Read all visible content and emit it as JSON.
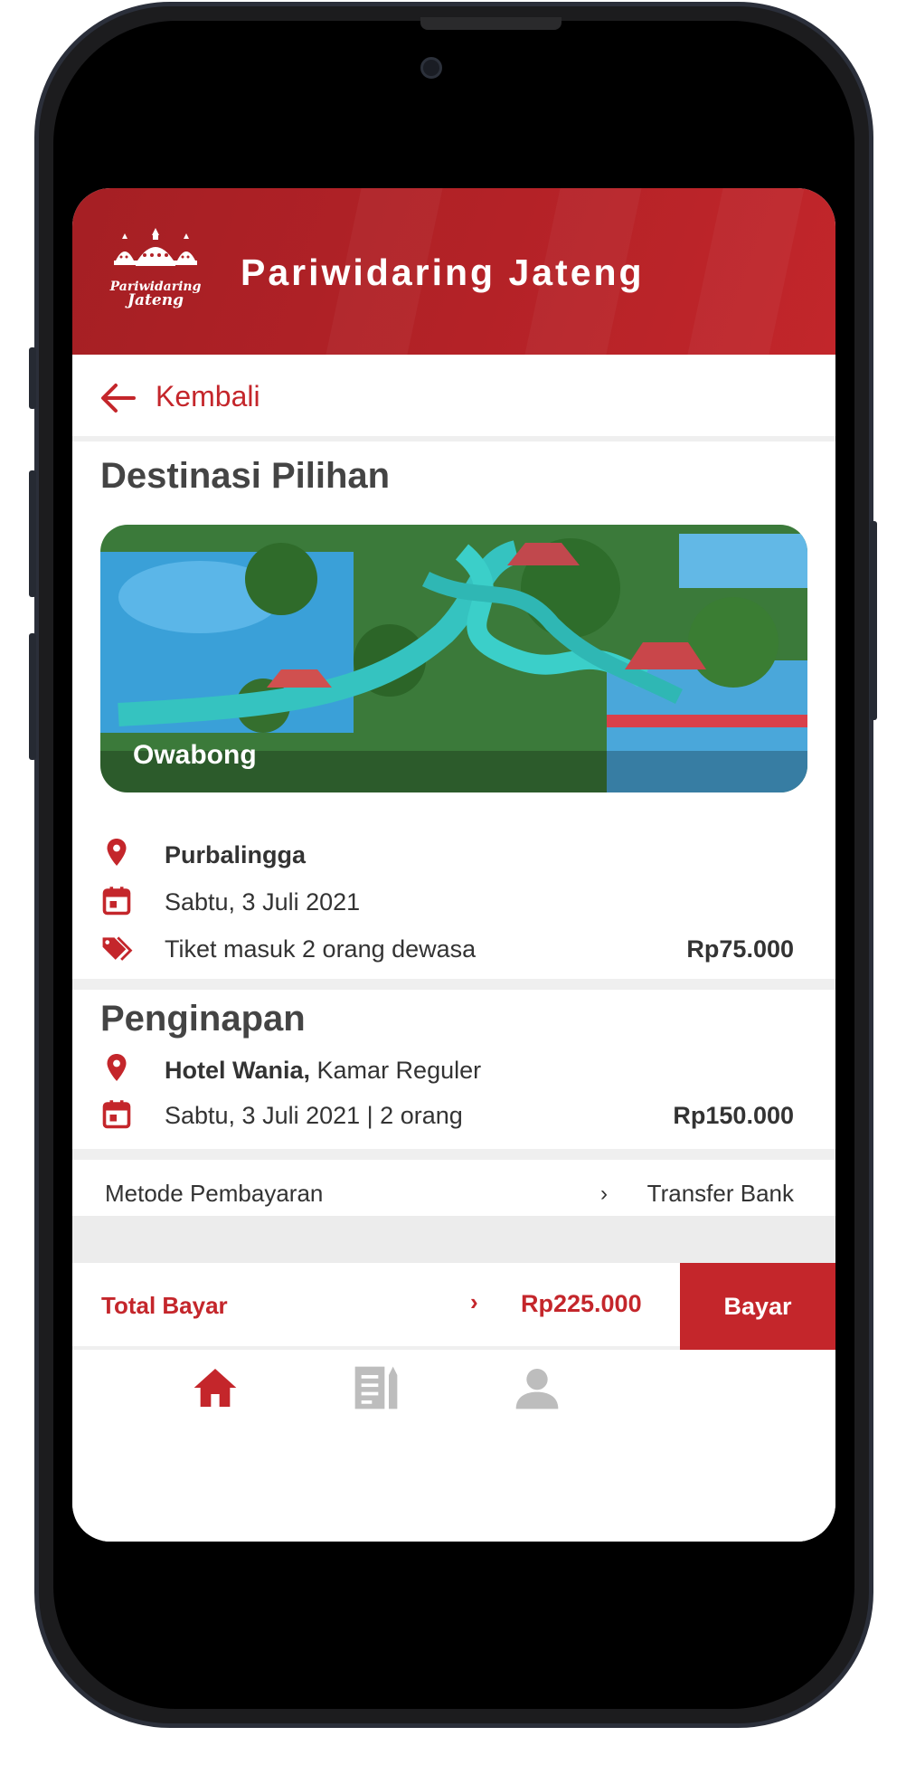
{
  "app": {
    "title": "Pariwidaring Jateng",
    "logo_text_1": "Pariwidaring",
    "logo_text_2": "Jateng"
  },
  "colors": {
    "brand_red": "#c4262b",
    "header_red": "#b42227",
    "text_dark": "#333333",
    "heading": "#444444"
  },
  "nav": {
    "back_label": "Kembali"
  },
  "destination": {
    "section_title": "Destinasi Pilihan",
    "image_caption": "Owabong",
    "location": "Purbalingga",
    "date": "Sabtu, 3 Juli 2021",
    "ticket_desc": "Tiket masuk 2 orang dewasa",
    "ticket_price": "Rp75.000"
  },
  "lodging": {
    "section_title": "Penginapan",
    "hotel_name": "Hotel Wania,",
    "room_type": "Kamar Reguler",
    "date_people": "Sabtu, 3 Juli 2021 | 2 orang",
    "price": "Rp150.000"
  },
  "payment": {
    "label": "Metode Pembayaran",
    "chevron": "›",
    "value": "Transfer Bank"
  },
  "total": {
    "label": "Total Bayar",
    "chevron": "›",
    "amount": "Rp225.000",
    "button_label": "Bayar"
  },
  "bottom_nav": {
    "items": [
      {
        "icon": "home-icon",
        "active": true
      },
      {
        "icon": "document-icon",
        "active": false
      },
      {
        "icon": "person-icon",
        "active": false
      }
    ]
  }
}
